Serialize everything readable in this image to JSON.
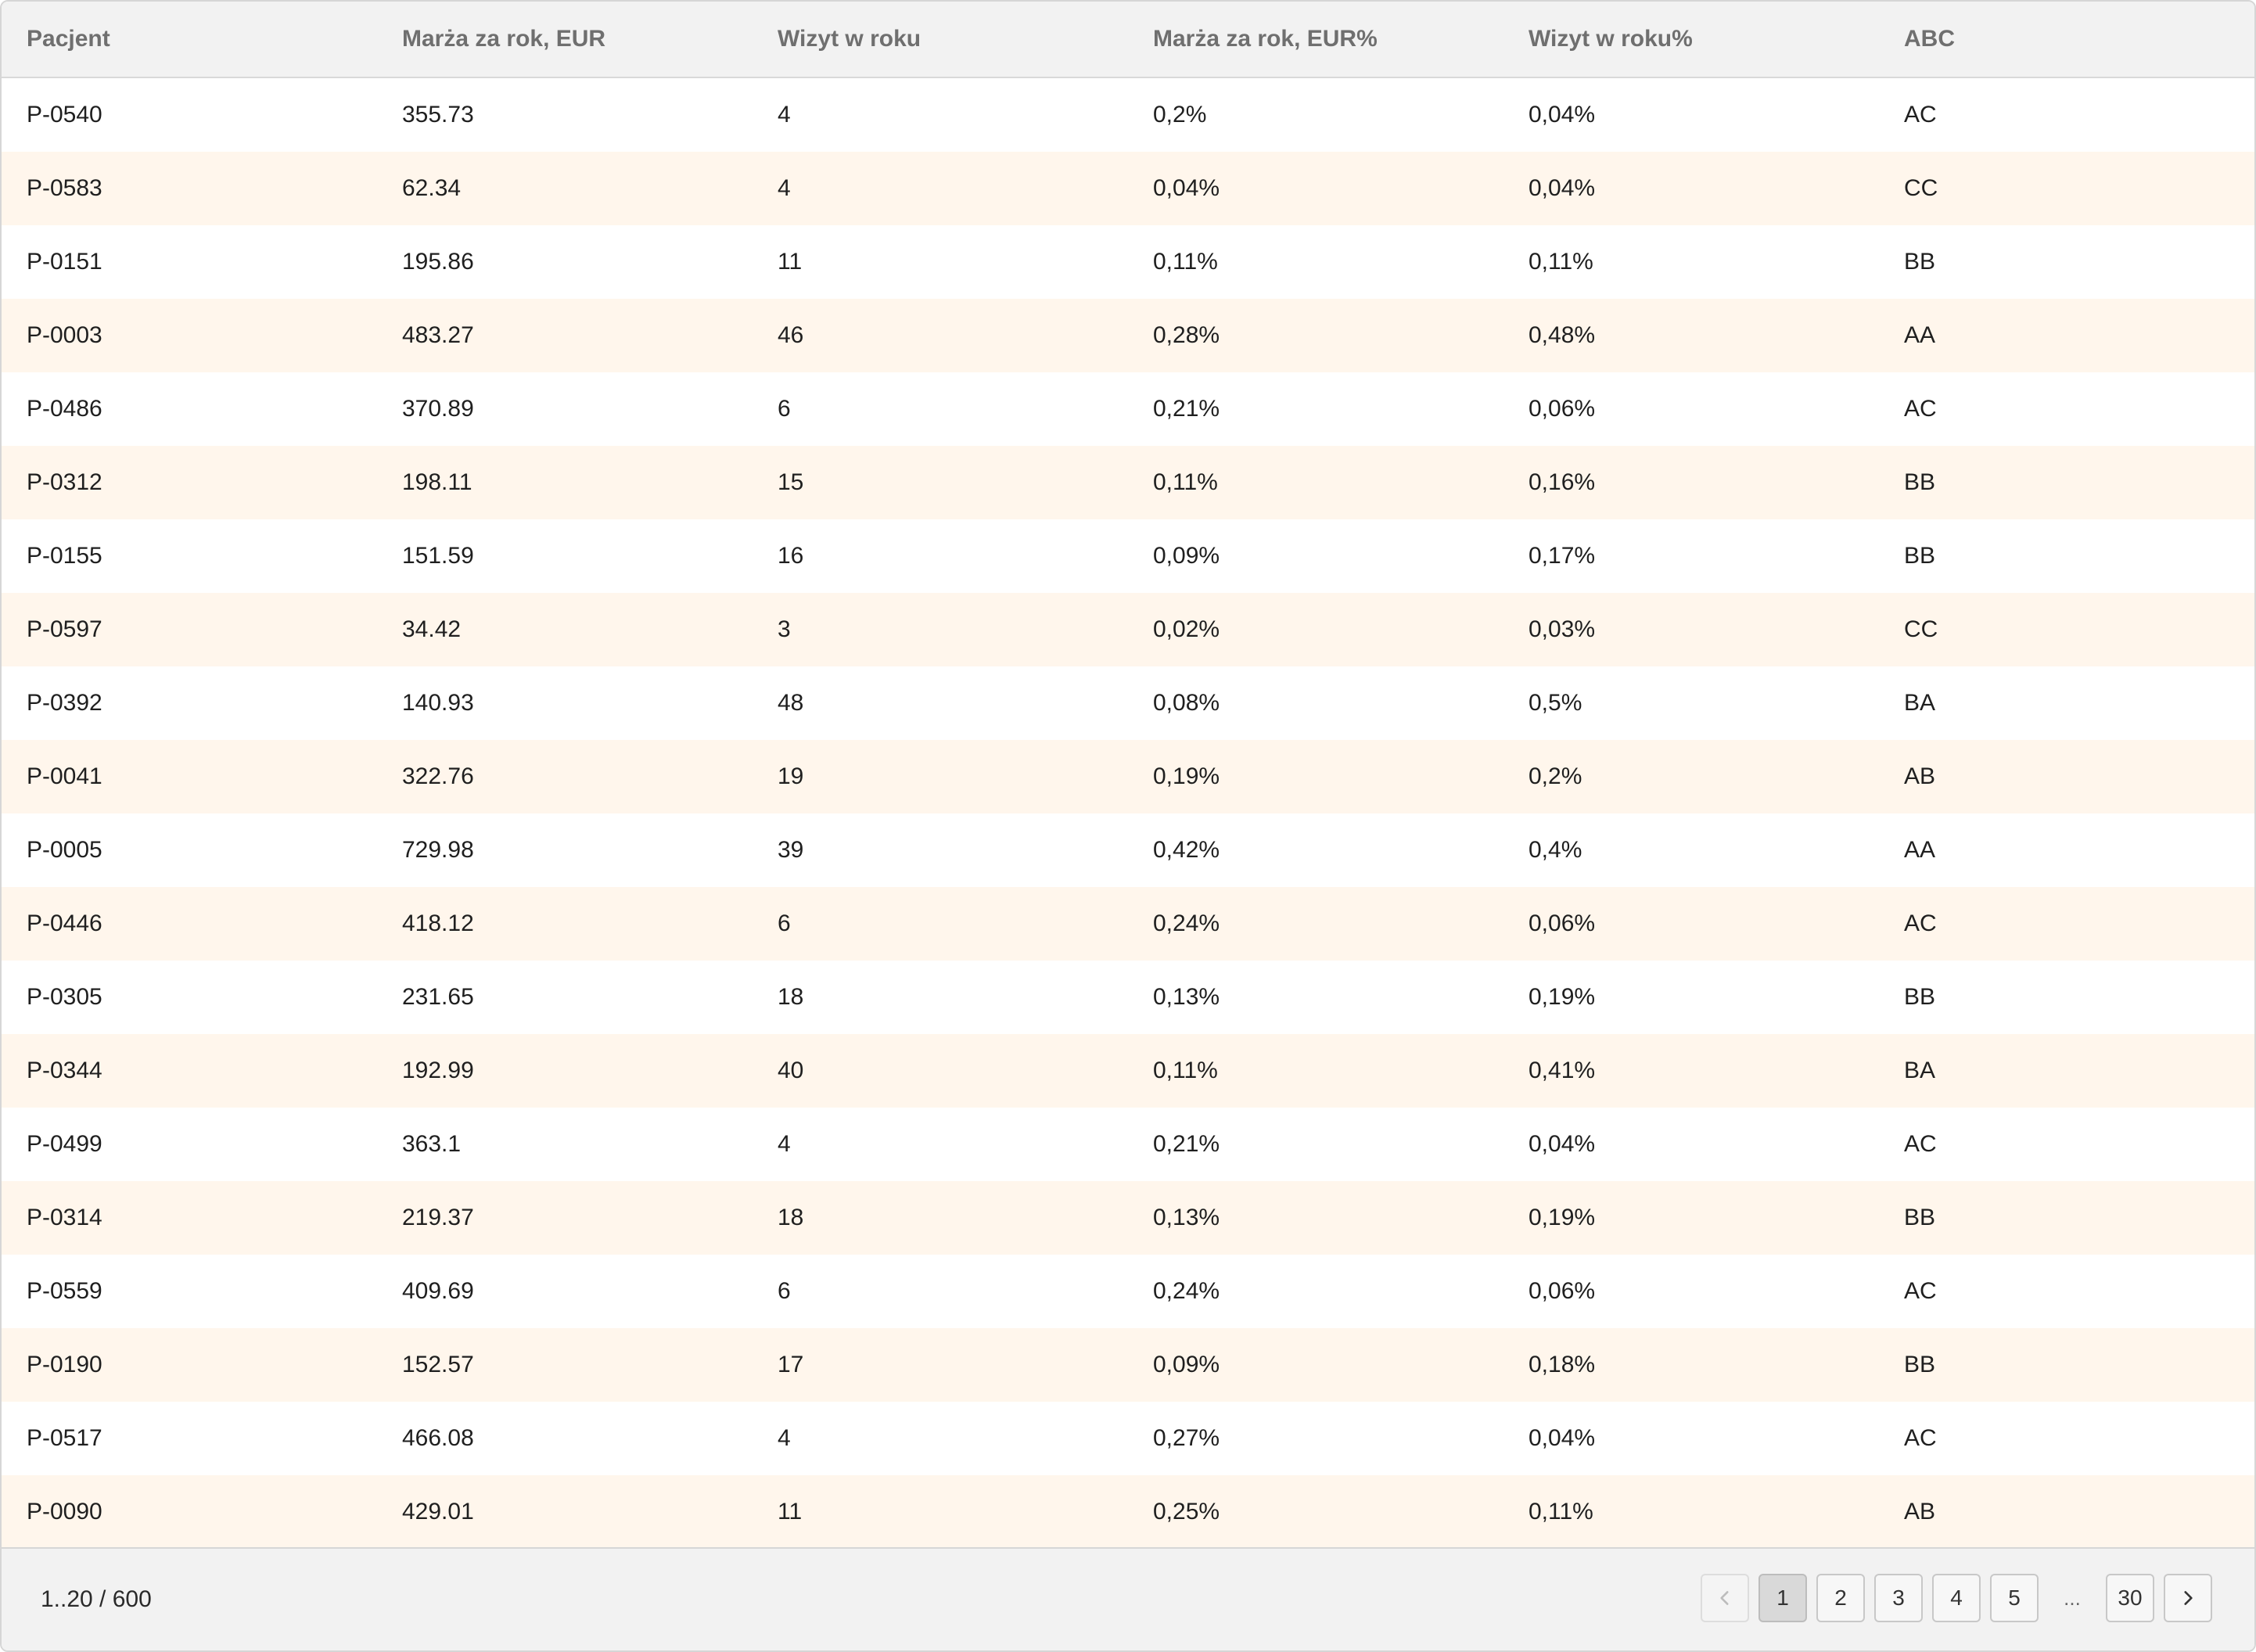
{
  "table": {
    "columns": [
      "Pacjent",
      "Marża za rok, EUR",
      "Wizyt w roku",
      "Marża za rok, EUR%",
      "Wizyt w roku%",
      "ABC"
    ],
    "rows": [
      [
        "P-0540",
        "355.73",
        "4",
        "0,2%",
        "0,04%",
        "AC"
      ],
      [
        "P-0583",
        "62.34",
        "4",
        "0,04%",
        "0,04%",
        "CC"
      ],
      [
        "P-0151",
        "195.86",
        "11",
        "0,11%",
        "0,11%",
        "BB"
      ],
      [
        "P-0003",
        "483.27",
        "46",
        "0,28%",
        "0,48%",
        "AA"
      ],
      [
        "P-0486",
        "370.89",
        "6",
        "0,21%",
        "0,06%",
        "AC"
      ],
      [
        "P-0312",
        "198.11",
        "15",
        "0,11%",
        "0,16%",
        "BB"
      ],
      [
        "P-0155",
        "151.59",
        "16",
        "0,09%",
        "0,17%",
        "BB"
      ],
      [
        "P-0597",
        "34.42",
        "3",
        "0,02%",
        "0,03%",
        "CC"
      ],
      [
        "P-0392",
        "140.93",
        "48",
        "0,08%",
        "0,5%",
        "BA"
      ],
      [
        "P-0041",
        "322.76",
        "19",
        "0,19%",
        "0,2%",
        "AB"
      ],
      [
        "P-0005",
        "729.98",
        "39",
        "0,42%",
        "0,4%",
        "AA"
      ],
      [
        "P-0446",
        "418.12",
        "6",
        "0,24%",
        "0,06%",
        "AC"
      ],
      [
        "P-0305",
        "231.65",
        "18",
        "0,13%",
        "0,19%",
        "BB"
      ],
      [
        "P-0344",
        "192.99",
        "40",
        "0,11%",
        "0,41%",
        "BA"
      ],
      [
        "P-0499",
        "363.1",
        "4",
        "0,21%",
        "0,04%",
        "AC"
      ],
      [
        "P-0314",
        "219.37",
        "18",
        "0,13%",
        "0,19%",
        "BB"
      ],
      [
        "P-0559",
        "409.69",
        "6",
        "0,24%",
        "0,06%",
        "AC"
      ],
      [
        "P-0190",
        "152.57",
        "17",
        "0,09%",
        "0,18%",
        "BB"
      ],
      [
        "P-0517",
        "466.08",
        "4",
        "0,27%",
        "0,04%",
        "AC"
      ],
      [
        "P-0090",
        "429.01",
        "11",
        "0,25%",
        "0,11%",
        "AB"
      ]
    ]
  },
  "footer": {
    "range_text": "1..20 / 600",
    "pages": [
      "1",
      "2",
      "3",
      "4",
      "5"
    ],
    "ellipsis": "...",
    "last_page": "30",
    "current_page": "1"
  }
}
